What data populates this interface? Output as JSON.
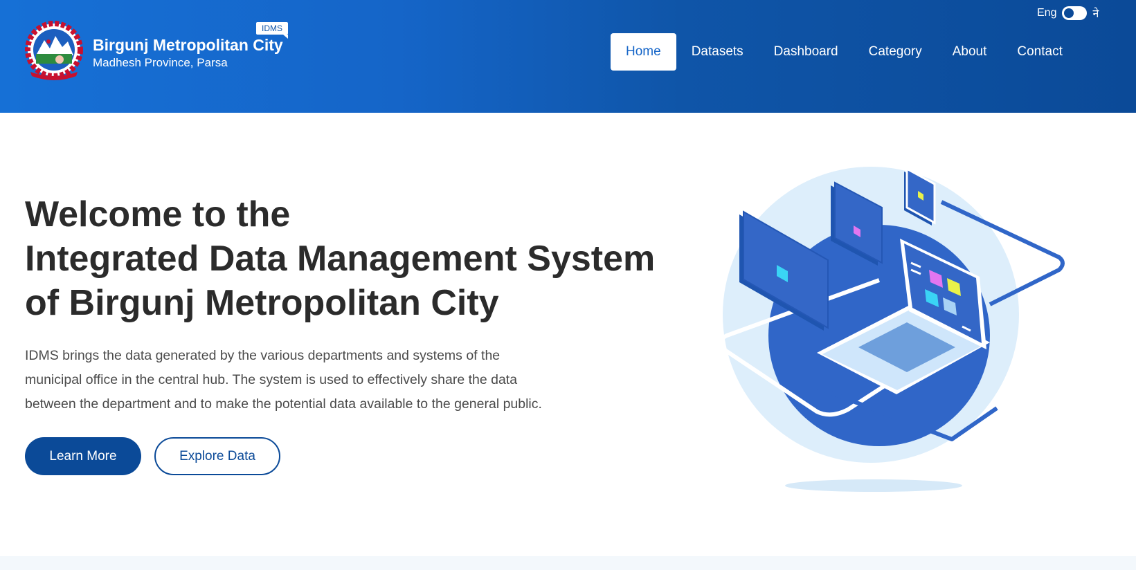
{
  "header": {
    "title": "Birgunj Metropolitan City",
    "subtitle": "Madhesh Province, Parsa",
    "badge": "IDMS",
    "logo_icon": "nepal-emblem-icon"
  },
  "language": {
    "current": "Eng",
    "alternate": "ने"
  },
  "nav": {
    "items": [
      {
        "label": "Home",
        "active": true
      },
      {
        "label": "Datasets"
      },
      {
        "label": "Dashboard"
      },
      {
        "label": "Category"
      },
      {
        "label": "About"
      },
      {
        "label": "Contact"
      }
    ]
  },
  "hero": {
    "heading_lines": [
      "Welcome to the",
      "Integrated Data Management System",
      "of Birgunj Metropolitan City"
    ],
    "description_lines": [
      "IDMS brings the data generated by the various departments and systems of the",
      "municipal office in the central hub. The system is used to effectively share the data",
      "between the department and to make the potential data available to the general public."
    ],
    "primary_button": "Learn More",
    "secondary_button": "Explore Data",
    "illustration_icon": "isometric-laptop-illustration"
  },
  "colors": {
    "header_start": "#1670d6",
    "header_end": "#0b4a98",
    "primary": "#0b4a98",
    "illustration_blue": "#3066c8",
    "illustration_light": "#ddeefb"
  }
}
